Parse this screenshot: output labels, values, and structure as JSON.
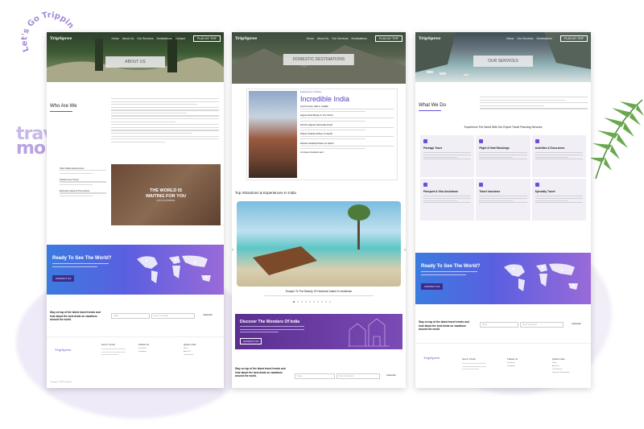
{
  "stamp": {
    "text": "Let's Go Tripping"
  },
  "sticker": {
    "line1": "travel",
    "line2": "more"
  },
  "brand": {
    "logo": "TripSpree",
    "accent": "#6b4fd6"
  },
  "nav": {
    "links": [
      "Home",
      "About Us",
      "Our Services",
      "Destinations",
      "Contact"
    ],
    "plan_button": "PLAN MY TRIP"
  },
  "about_page": {
    "banner_title": "ABOUT US",
    "section_title": "Who Are We",
    "features": [
      "Tailor Made Experiences",
      "Hassle-Free Travel",
      "Exclusive Deals & Promotions"
    ],
    "image_text": {
      "line1": "THE WORLD IS",
      "line2": "WAITING FOR YOU",
      "tag": "LET'S GO TRIPPING"
    }
  },
  "destinations_page": {
    "banner_title": "DOMESTIC DESTINATIONS",
    "eyebrow": "Exploring Our Ordinary",
    "title": "Incredible India",
    "items": [
      "Avid Country Hills in Ladakh",
      "Highest Rail Bridge In The World",
      "World's Highest Motorable Road",
      "Oldest Inhabited Place On Earth",
      "Wettest Inhabited Place On Earth",
      "A Unique Festival Land"
    ],
    "attractions_title": "Top Attractions & Experiences In India",
    "slide_caption": "Escape To The Beauty Of Havelock Island In Andaman",
    "discover_title": "Discover The Wonders Of India",
    "discover_button": "CONTACT US"
  },
  "services_page": {
    "banner_title": "OUR SERVICES",
    "section_title": "What We Do",
    "grid_heading": "Experience The World With Our Expert Travel Planning Services",
    "services": [
      "Package Tours",
      "Flight & Hotel Bookings",
      "Activities & Excursions",
      "Passport & Visa Assistance",
      "Travel Insurance",
      "Specialty Travel"
    ]
  },
  "cta": {
    "title": "Ready To See The World?",
    "button": "CONTACT US"
  },
  "newsletter": {
    "text": "Stay on top of the latest travel trends and hear about the best deals on vacations around the world.",
    "name_placeholder": "Name",
    "email_placeholder": "Enter Your Email",
    "subscribe": "Subscribe"
  },
  "footer": {
    "get_in_touch": "Get In Touch",
    "follow_us": "Follow Us",
    "quick_links": "Quick Links",
    "social": [
      "Facebook",
      "Instagram"
    ],
    "links": [
      "Home",
      "About Us",
      "Our Services",
      "Domestic Destinations",
      "International Destinations",
      "Contact Us"
    ],
    "copyright": "Copyright © 2023 TripSpree"
  }
}
